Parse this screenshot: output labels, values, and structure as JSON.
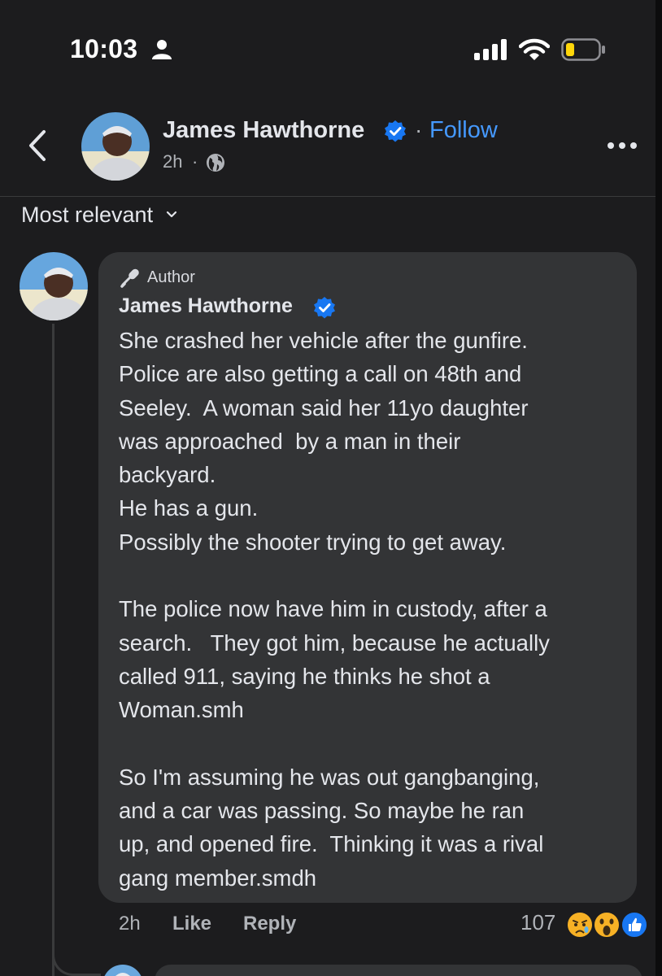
{
  "status_bar": {
    "time": "10:03",
    "icons": [
      "person-icon",
      "signal-icon",
      "wifi-icon",
      "battery-icon"
    ]
  },
  "header": {
    "author_name": "James Hawthorne",
    "separator": "·",
    "follow_label": "Follow",
    "time": "2h",
    "time_separator": "·",
    "icons": [
      "back-icon",
      "verified-icon",
      "globe-icon",
      "more-icon"
    ]
  },
  "sort": {
    "label": "Most relevant",
    "icon": "chevron-down-icon"
  },
  "comment": {
    "badge_label": "Author",
    "author_name": "James Hawthorne",
    "body_lines": [
      "She crashed her vehicle after the gunfire.",
      "Police are also getting a call on 48th and",
      "Seeley.  A woman said her 11yo daughter",
      "was approached  by a man in their",
      "backyard.",
      "He has a gun.",
      "Possibly the shooter trying to get away.",
      "",
      "The police now have him in custody, after a",
      "search.   They got him, because he actually",
      "called 911, saying he thinks he shot a",
      "Woman.smh",
      "",
      "So I'm assuming he was out gangbanging,",
      "and a car was passing. So maybe he ran",
      "up, and opened fire.  Thinking it was a rival",
      "gang member.smdh"
    ],
    "time": "2h",
    "like_label": "Like",
    "reply_label": "Reply",
    "reaction_count": "107",
    "reactions": [
      "sad",
      "wow",
      "like"
    ]
  },
  "colors": {
    "background": "#1c1c1e",
    "bubble": "#333436",
    "link_blue": "#4599ff",
    "verified_blue": "#1877f2",
    "secondary_text": "#b0b3b8"
  }
}
